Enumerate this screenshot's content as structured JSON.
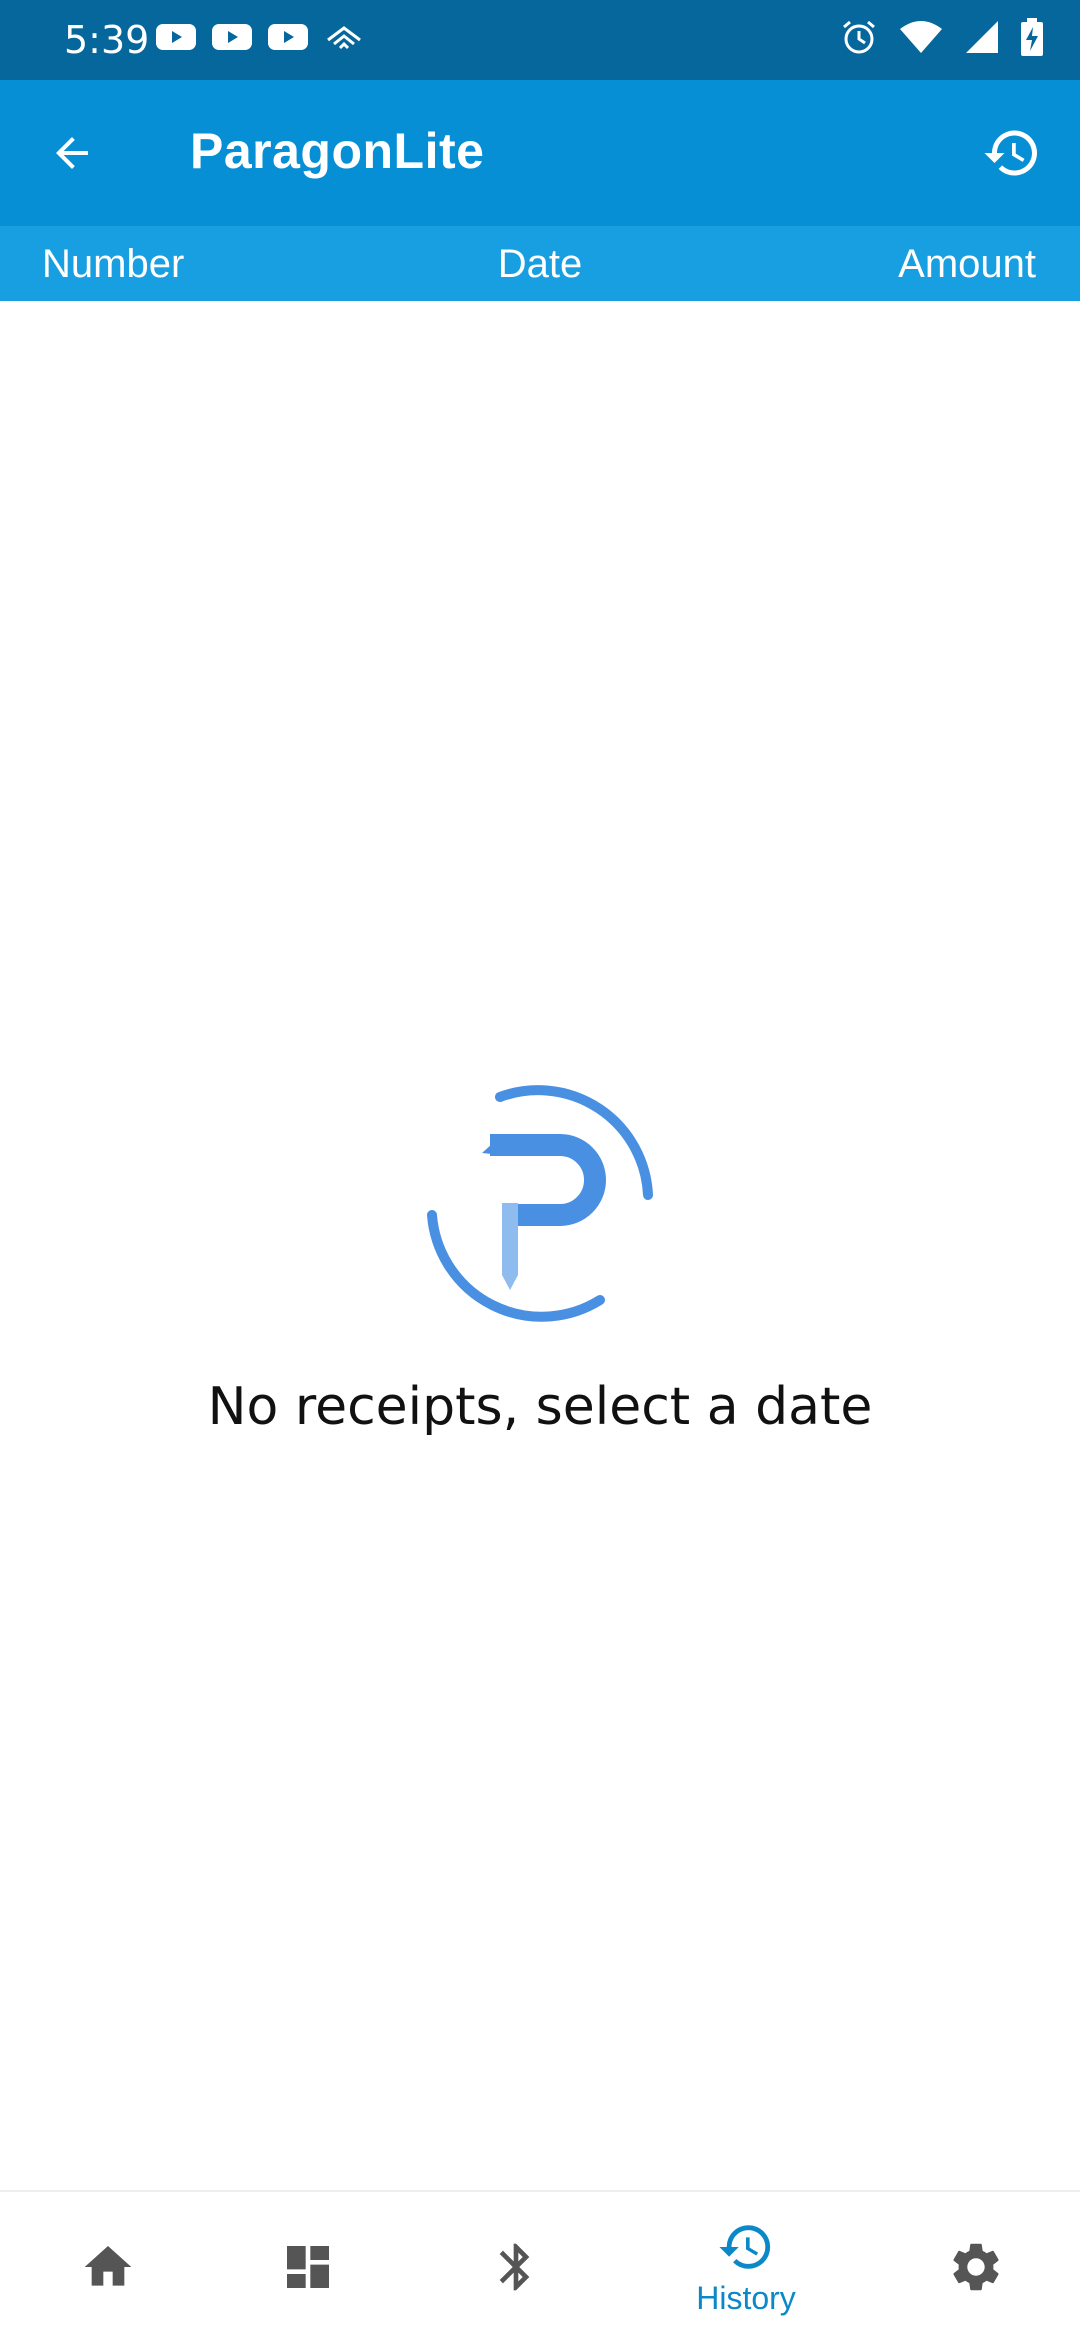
{
  "status_bar": {
    "time": "5:39",
    "left_icons": [
      "youtube-icon",
      "youtube-icon",
      "youtube-icon",
      "signal-app-icon"
    ],
    "right_icons": [
      "alarm-icon",
      "wifi-icon",
      "cell-signal-icon",
      "battery-charging-icon"
    ],
    "color": "#05679b"
  },
  "app_bar": {
    "title": "ParagonLite",
    "color": "#078fd6",
    "back_icon": "arrow-back-icon",
    "action_icon": "history-icon"
  },
  "columns": {
    "number": "Number",
    "date": "Date",
    "amount": "Amount",
    "color": "#189fe1"
  },
  "empty_state": {
    "message": "No receipts, select a date",
    "logo_color": "#4a90e2"
  },
  "bottom_nav": {
    "items": [
      {
        "icon": "home-icon",
        "label": ""
      },
      {
        "icon": "dashboard-icon",
        "label": ""
      },
      {
        "icon": "bluetooth-icon",
        "label": ""
      },
      {
        "icon": "history-icon",
        "label": "History",
        "active": true
      },
      {
        "icon": "settings-icon",
        "label": ""
      }
    ],
    "active_color": "#0a88c8",
    "inactive_color": "#555555"
  }
}
